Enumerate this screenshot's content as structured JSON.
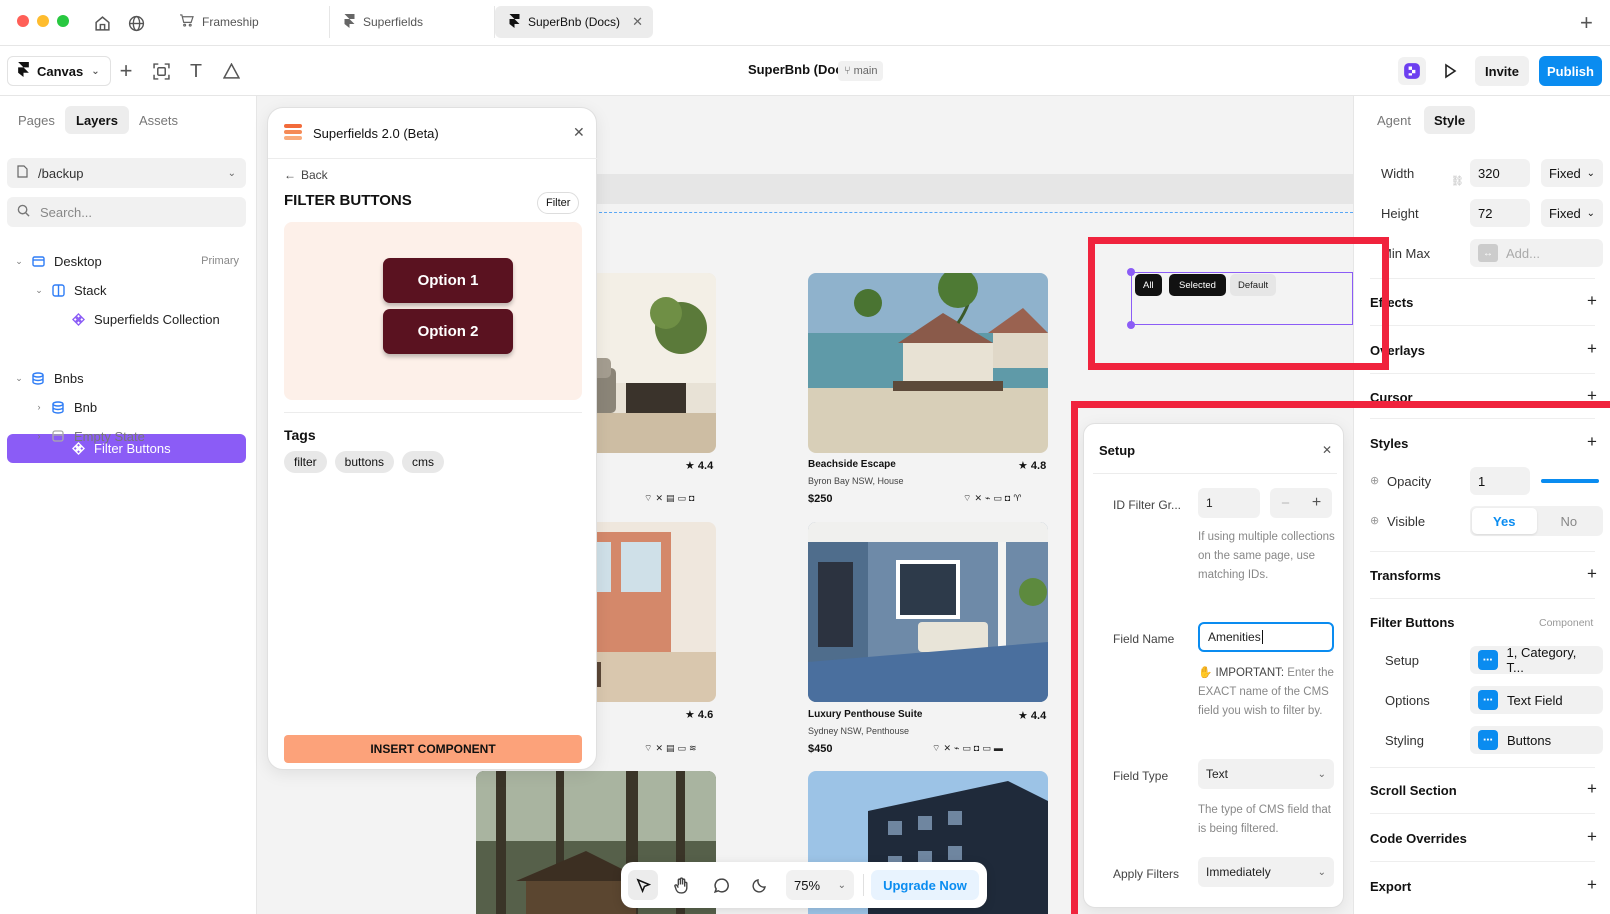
{
  "tabbar": {
    "tabs": [
      {
        "label": "Frameship"
      },
      {
        "label": "Superfields"
      },
      {
        "label": "SuperBnb (Docs)"
      }
    ]
  },
  "toolbar": {
    "canvas_label": "Canvas",
    "project_title": "SuperBnb (Docs)",
    "branch": "main",
    "invite_label": "Invite",
    "publish_label": "Publish"
  },
  "left_panel": {
    "tabs": [
      "Pages",
      "Layers",
      "Assets"
    ],
    "page_select": "/backup",
    "search_placeholder": "Search...",
    "layers": [
      {
        "label": "Desktop",
        "badge": "Primary"
      },
      {
        "label": "Stack"
      },
      {
        "label": "Superfields Collection"
      },
      {
        "label": "Filter Buttons"
      },
      {
        "label": "Bnbs"
      },
      {
        "label": "Bnb"
      },
      {
        "label": "Empty State"
      }
    ]
  },
  "plugin": {
    "title": "Superfields 2.0 (Beta)",
    "back_label": "Back",
    "heading": "FILTER BUTTONS",
    "tag_badge": "Filter",
    "preview_options": [
      "Option 1",
      "Option 2"
    ],
    "tags_heading": "Tags",
    "tags": [
      "filter",
      "buttons",
      "cms"
    ],
    "insert_label": "INSERT COMPONENT"
  },
  "canvas": {
    "filter_chips": [
      "All",
      "Selected",
      "Default"
    ],
    "cards": [
      {
        "rating": "4.4"
      },
      {
        "title": "Beachside Escape",
        "subtitle": "Byron Bay NSW, House",
        "price": "$250",
        "rating": "4.8"
      },
      {
        "rating": "4.6"
      },
      {
        "title": "Luxury Penthouse Suite",
        "subtitle": "Sydney NSW, Penthouse",
        "price": "$450",
        "rating": "4.4"
      }
    ]
  },
  "setup": {
    "title": "Setup",
    "id_label": "ID Filter Gr...",
    "id_value": "1",
    "id_help": "If using multiple collections on the same page, use matching IDs.",
    "field_name_label": "Field Name",
    "field_name_value": "Amenities",
    "field_name_help_prefix": "✋ IMPORTANT:",
    "field_name_help": " Enter the EXACT name of the CMS field you wish to filter by.",
    "field_type_label": "Field Type",
    "field_type_value": "Text",
    "field_type_help": "The type of CMS field that is being filtered.",
    "apply_label": "Apply Filters",
    "apply_value": "Immediately"
  },
  "right_panel": {
    "tabs": [
      "Agent",
      "Style"
    ],
    "width_label": "Width",
    "width_value": "320",
    "width_mode": "Fixed",
    "height_label": "Height",
    "height_value": "72",
    "height_mode": "Fixed",
    "minmax_label": "Min Max",
    "minmax_placeholder": "Add...",
    "effects": "Effects",
    "overlays": "Overlays",
    "cursor": "Cursor",
    "styles": "Styles",
    "opacity_label": "Opacity",
    "opacity_value": "1",
    "opacity_level": 1,
    "visible_label": "Visible",
    "visible_yes": "Yes",
    "visible_no": "No",
    "transforms": "Transforms",
    "component_title": "Filter Buttons",
    "component_badge": "Component",
    "props": [
      {
        "label": "Setup",
        "value": "1, Category, T..."
      },
      {
        "label": "Options",
        "value": "Text Field"
      },
      {
        "label": "Styling",
        "value": "Buttons"
      }
    ],
    "scroll_section": "Scroll Section",
    "code_overrides": "Code Overrides",
    "export": "Export"
  },
  "floatbar": {
    "zoom": "75%",
    "upgrade_label": "Upgrade Now"
  },
  "colors": {
    "accent_blue": "#0a8cf0",
    "selection_purple": "#8b5cf6",
    "highlight_red": "#f0233d",
    "option_maroon": "#5a1220",
    "insert_orange": "#fca27a"
  }
}
